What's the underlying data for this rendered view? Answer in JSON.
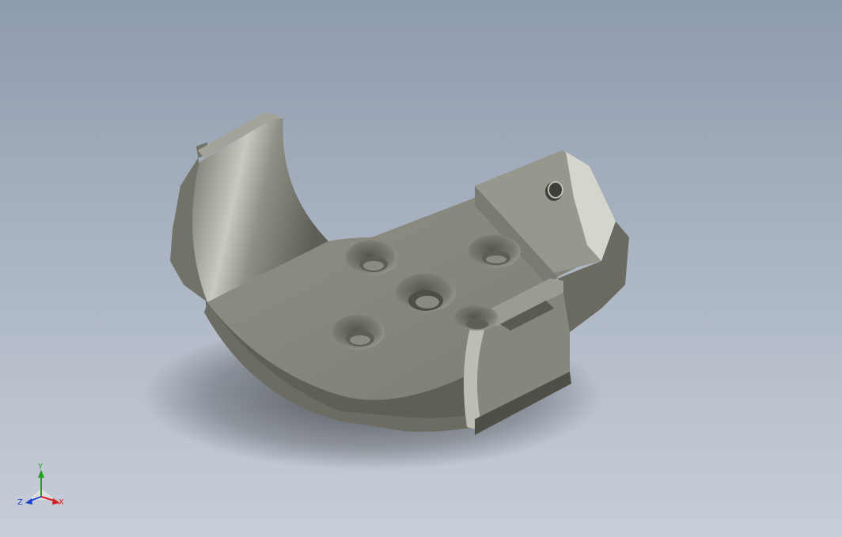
{
  "viewport": {
    "background_top": "#8e9bae",
    "background_bottom": "#c8ced8",
    "model_color": "#8b8b80"
  },
  "triad": {
    "x_label": "X",
    "y_label": "Y",
    "z_label": "Z",
    "x_color": "#d42020",
    "y_color": "#20a020",
    "z_color": "#2040d0"
  }
}
